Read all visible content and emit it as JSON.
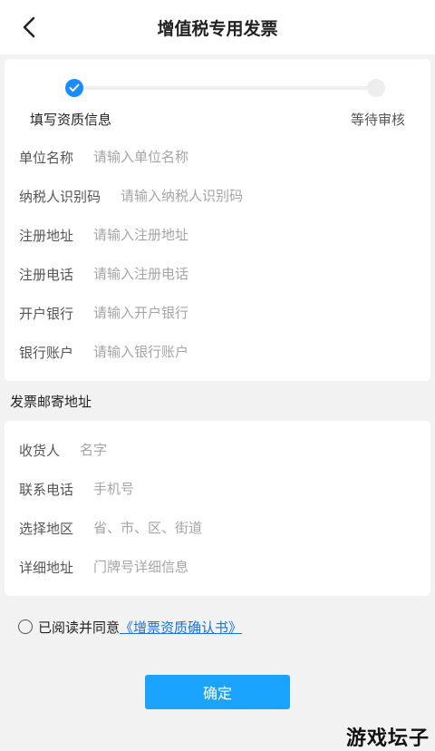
{
  "header": {
    "title": "增值税专用发票"
  },
  "steps": [
    {
      "label": "填写资质信息",
      "done": true
    },
    {
      "label": "等待审核",
      "done": false
    }
  ],
  "company_fields": [
    {
      "label": "单位名称",
      "placeholder": "请输入单位名称"
    },
    {
      "label": "纳税人识别码",
      "placeholder": "请输入纳税人识别码"
    },
    {
      "label": "注册地址",
      "placeholder": "请输入注册地址"
    },
    {
      "label": "注册电话",
      "placeholder": "请输入注册电话"
    },
    {
      "label": "开户银行",
      "placeholder": "请输入开户银行"
    },
    {
      "label": "银行账户",
      "placeholder": "请输入银行账户"
    }
  ],
  "mailing": {
    "section_title": "发票邮寄地址",
    "fields": [
      {
        "label": "收货人",
        "placeholder": "名字"
      },
      {
        "label": "联系电话",
        "placeholder": "手机号"
      },
      {
        "label": "选择地区",
        "placeholder": "省、市、区、街道"
      },
      {
        "label": "详细地址",
        "placeholder": "门牌号详细信息"
      }
    ]
  },
  "agreement": {
    "prefix": "已阅读并同意",
    "link": "《增票资质确认书》"
  },
  "confirm_label": "确定",
  "watermark": "游戏坛子",
  "colors": {
    "accent": "#1a8cff",
    "button": "#1aa3ff",
    "link": "#1a73d9"
  }
}
